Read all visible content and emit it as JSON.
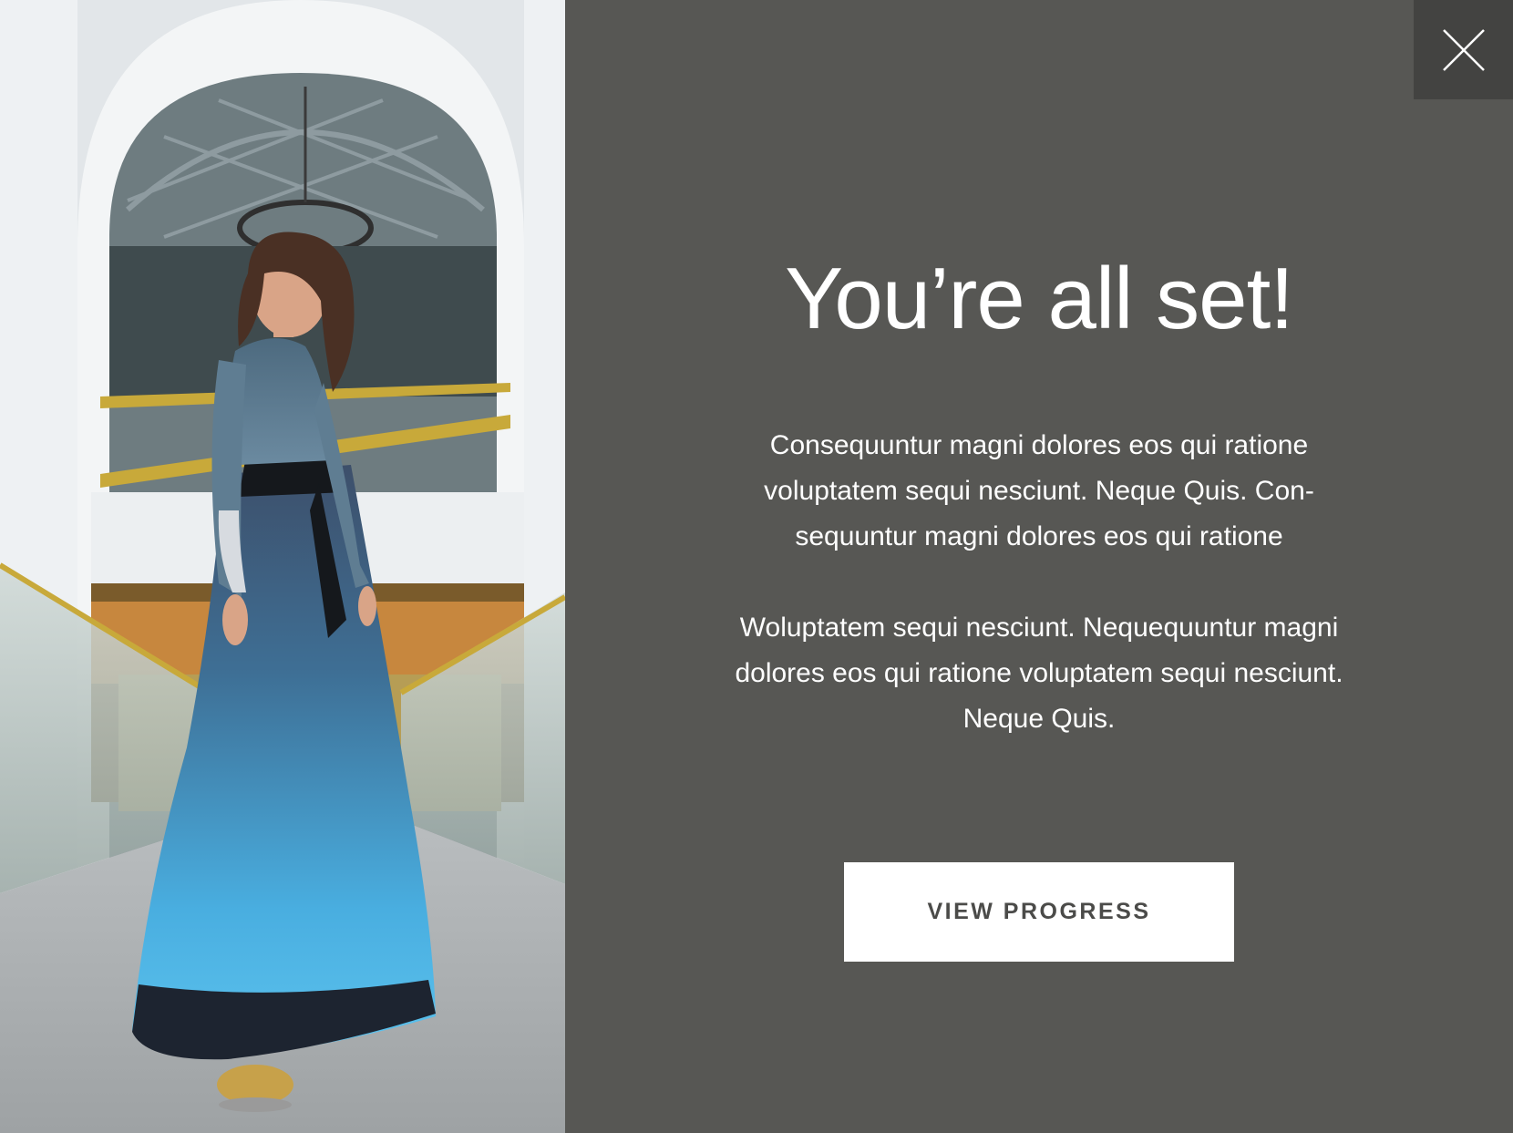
{
  "dialog": {
    "title": "You’re all set!",
    "paragraphs": [
      "Consequuntur magni dolores eos qui ratione voluptatem sequi nesciunt. Neque Quis. Con-sequuntur magni dolores eos qui ratione",
      "Woluptatem sequi nesciunt. Nequequuntur magni dolores eos qui ratione voluptatem sequi nesciunt. Neque Quis."
    ],
    "primary_button_label": "VIEW PROGRESS",
    "close_icon": "close-icon"
  },
  "image": {
    "description_icon": "fashion-photo"
  },
  "colors": {
    "panel_background": "#575754",
    "close_background": "#434341",
    "button_background": "#ffffff",
    "button_text": "#4b4b49",
    "text": "#ffffff"
  }
}
